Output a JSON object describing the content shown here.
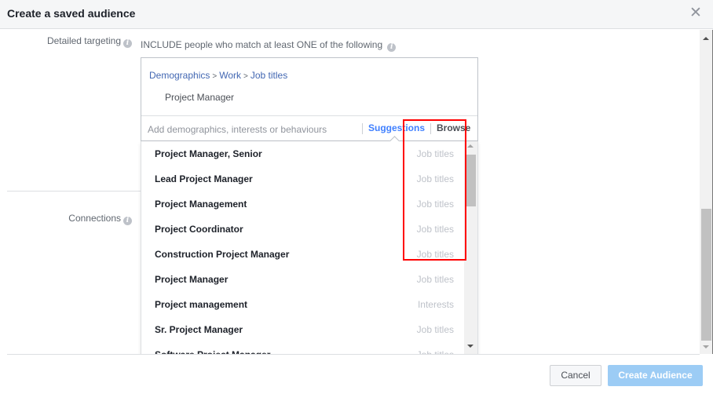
{
  "dialog": {
    "title": "Create a saved audience",
    "close_icon": "close-icon"
  },
  "form": {
    "detailed_targeting_label": "Detailed targeting",
    "include_text": "INCLUDE people who match at least ONE of the following",
    "connections_label": "Connections",
    "info_icon_glyph": "i"
  },
  "targeting": {
    "breadcrumb": [
      "Demographics",
      "Work",
      "Job titles"
    ],
    "breadcrumb_separator": ">",
    "selected": "Project Manager",
    "search_placeholder": "Add demographics, interests or behaviours",
    "search_value": "",
    "tabs": {
      "suggestions": "Suggestions",
      "browse": "Browse",
      "active": "suggestions"
    }
  },
  "suggestions": [
    {
      "name": "Project Manager, Senior",
      "category": "Job titles"
    },
    {
      "name": "Lead Project Manager",
      "category": "Job titles"
    },
    {
      "name": "Project Management",
      "category": "Job titles"
    },
    {
      "name": "Project Coordinator",
      "category": "Job titles"
    },
    {
      "name": "Construction Project Manager",
      "category": "Job titles"
    },
    {
      "name": "Project Manager",
      "category": "Job titles"
    },
    {
      "name": "Project management",
      "category": "Interests"
    },
    {
      "name": "Sr. Project Manager",
      "category": "Job titles"
    },
    {
      "name": "Software Project Manager",
      "category": "Job titles"
    }
  ],
  "annotation": {
    "highlight_color": "#ff0000"
  },
  "footer": {
    "cancel_label": "Cancel",
    "create_label": "Create Audience"
  },
  "colors": {
    "link": "#4267b2",
    "active_tab": "#4080ff",
    "primary_disabled": "#9cccf5"
  }
}
